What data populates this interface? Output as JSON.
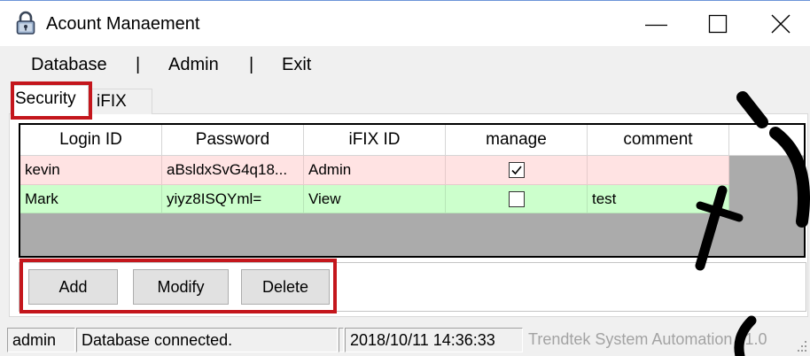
{
  "window": {
    "title": "Acount Manaement",
    "app_icon": "lock-icon",
    "control_icons": [
      "minimize-icon",
      "maximize-icon",
      "close-icon"
    ]
  },
  "menu": {
    "items": [
      {
        "label": "Database"
      },
      {
        "label": "|"
      },
      {
        "label": "Admin"
      },
      {
        "label": "|"
      },
      {
        "label": "Exit"
      }
    ]
  },
  "tabs": [
    {
      "label": "Security",
      "selected": true
    },
    {
      "label": "iFIX",
      "selected": false
    }
  ],
  "grid": {
    "columns": [
      "Login ID",
      "Password",
      "iFIX ID",
      "manage",
      "comment"
    ],
    "rows": [
      {
        "login_id": "kevin",
        "password": "aBsldxSvG4q18...",
        "ifix_id": "Admin",
        "manage": true,
        "comment": "",
        "row_color": "#ffe3e3"
      },
      {
        "login_id": "Mark",
        "password": "yiyz8ISQYml=",
        "ifix_id": "View",
        "manage": false,
        "comment": "test",
        "row_color": "#ccffcc"
      }
    ]
  },
  "buttons": {
    "add": "Add",
    "modify": "Modify",
    "delete": "Delete"
  },
  "status_bar": {
    "user": "admin",
    "message": "Database connected.",
    "timestamp": "2018/10/11 14:36:33",
    "version": "Trendtek System Automation v1.0",
    "grip_icon": "resize-grip-icon"
  },
  "colors": {
    "annotation": "#c4161c",
    "grid_background": "#ababab",
    "disabled_text": "#a3a3a3"
  }
}
